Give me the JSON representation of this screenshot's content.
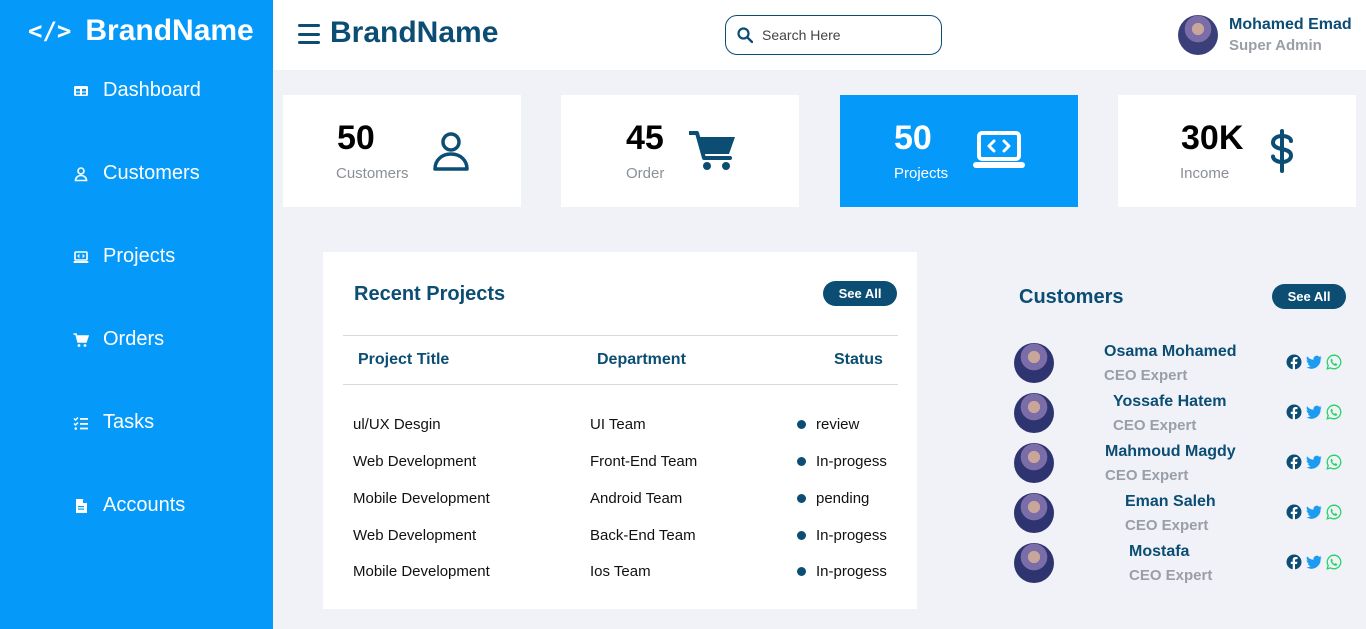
{
  "sidebar": {
    "brand": "BrandName",
    "items": [
      {
        "label": "Dashboard",
        "icon": "dashboard-icon"
      },
      {
        "label": "Customers",
        "icon": "user-icon"
      },
      {
        "label": "Projects",
        "icon": "laptop-code-icon"
      },
      {
        "label": "Orders",
        "icon": "cart-icon"
      },
      {
        "label": "Tasks",
        "icon": "tasks-icon"
      },
      {
        "label": "Accounts",
        "icon": "file-icon"
      }
    ]
  },
  "header": {
    "brand": "BrandName",
    "search_placeholder": "Search Here",
    "user": {
      "name": "Mohamed Emad",
      "role": "Super Admin"
    }
  },
  "stats": [
    {
      "value": "50",
      "label": "Customers",
      "icon": "user-icon"
    },
    {
      "value": "45",
      "label": "Order",
      "icon": "cart-icon"
    },
    {
      "value": "50",
      "label": "Projects",
      "icon": "laptop-code-icon"
    },
    {
      "value": "30K",
      "label": "Income",
      "icon": "dollar-icon"
    }
  ],
  "recent_projects": {
    "title": "Recent Projects",
    "see_all": "See All",
    "columns": [
      "Project Title",
      "Department",
      "Status"
    ],
    "rows": [
      {
        "title": "ul/UX Desgin",
        "department": "UI Team",
        "status": "review"
      },
      {
        "title": "Web Development",
        "department": "Front-End Team",
        "status": "In-progess"
      },
      {
        "title": "Mobile Development",
        "department": "Android Team",
        "status": "pending"
      },
      {
        "title": "Web Development",
        "department": "Back-End Team",
        "status": "In-progess"
      },
      {
        "title": "Mobile Development",
        "department": "Ios Team",
        "status": "In-progess"
      }
    ]
  },
  "customers": {
    "title": "Customers",
    "see_all": "See All",
    "items": [
      {
        "name": "Osama Mohamed",
        "role": "CEO Expert"
      },
      {
        "name": "Yossafe Hatem",
        "role": "CEO Expert"
      },
      {
        "name": "Mahmoud Magdy",
        "role": "CEO Expert"
      },
      {
        "name": "Eman Saleh",
        "role": "CEO Expert"
      },
      {
        "name": "Mostafa",
        "role": "CEO Expert"
      }
    ]
  },
  "colors": {
    "primary": "#0599f9",
    "dark": "#0c4d74",
    "background": "#f0f2f7",
    "facebook": "#0c4d74",
    "twitter": "#1d9bf0",
    "whatsapp": "#25d366"
  }
}
